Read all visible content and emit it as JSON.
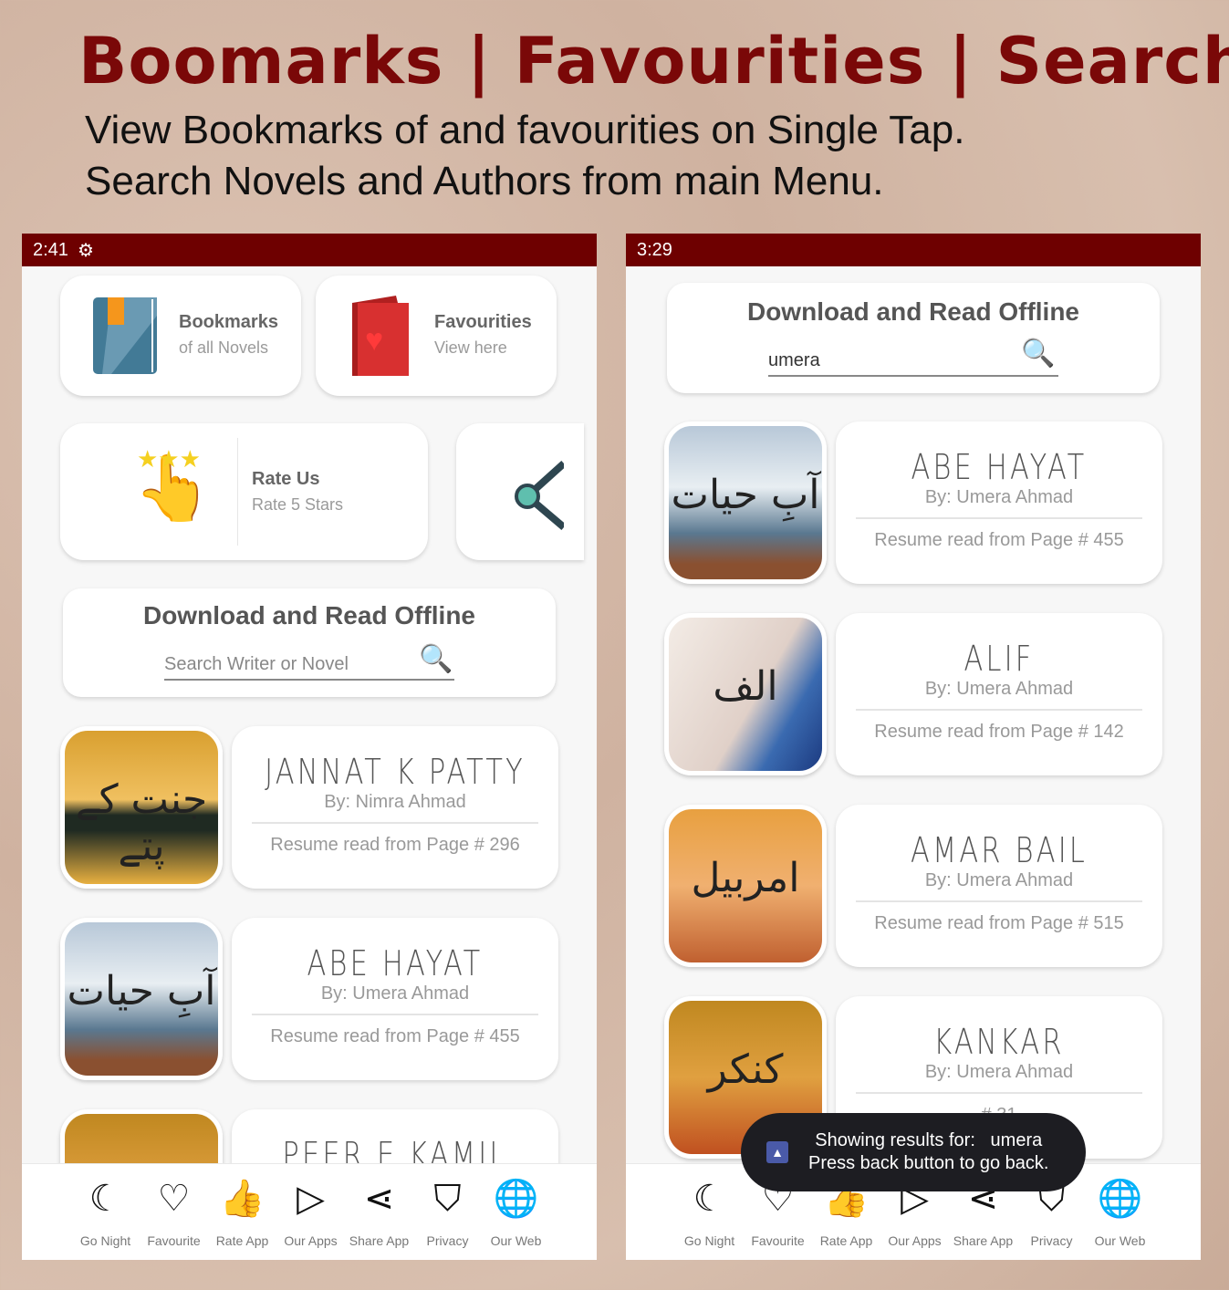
{
  "header": {
    "title": "Boomarks | Favourities | Search",
    "subtitle_line1": "View Bookmarks of and favourities on Single Tap.",
    "subtitle_line2": "Search Novels and Authors from main Menu."
  },
  "left": {
    "time": "2:41",
    "bookmarks": {
      "title": "Bookmarks",
      "subtitle": "of all Novels"
    },
    "favourites": {
      "title": "Favourities",
      "subtitle": "View here"
    },
    "rate": {
      "title": "Rate Us",
      "subtitle": "Rate 5 Stars"
    },
    "search": {
      "title": "Download and Read Offline",
      "value": "",
      "placeholder": "Search Writer or Novel"
    },
    "novels": [
      {
        "title": "JANNAT K PATTY",
        "author": "By: Nimra Ahmad",
        "resume": "Resume read from Page # 296",
        "cover_text": "جنت کے پتے"
      },
      {
        "title": "ABE HAYAT",
        "author": "By: Umera Ahmad",
        "resume": "Resume read from Page # 455",
        "cover_text": "آبِ حیات"
      },
      {
        "title": "PEER E KAMIL",
        "author": "",
        "resume": "",
        "cover_text": ""
      }
    ]
  },
  "right": {
    "time": "3:29",
    "search": {
      "title": "Download and Read Offline",
      "value": "umera",
      "placeholder": ""
    },
    "novels": [
      {
        "title": "ABE HAYAT",
        "author": "By: Umera Ahmad",
        "resume": "Resume read from Page # 455",
        "cover_text": "آبِ حیات"
      },
      {
        "title": "ALIF",
        "author": "By: Umera Ahmad",
        "resume": "Resume read from Page # 142",
        "cover_text": "الف"
      },
      {
        "title": "AMAR BAIL",
        "author": "By: Umera Ahmad",
        "resume": "Resume read from Page # 515",
        "cover_text": "امربیل"
      },
      {
        "title": "KANKAR",
        "author": "By: Umera Ahmad",
        "resume": "# 31",
        "cover_text": "کنکر"
      }
    ],
    "toast": {
      "line1": "Showing results for:   umera",
      "line2": "Press back button to go back."
    }
  },
  "nav": [
    {
      "label": "Go Night",
      "icon": "moon-icon",
      "glyph": "☾"
    },
    {
      "label": "Favourite",
      "icon": "heart-icon",
      "glyph": "♡"
    },
    {
      "label": "Rate App",
      "icon": "thumbs-up-icon",
      "glyph": "👍"
    },
    {
      "label": "Our Apps",
      "icon": "play-store-icon",
      "glyph": "▷"
    },
    {
      "label": "Share App",
      "icon": "share-icon",
      "glyph": "⋖"
    },
    {
      "label": "Privacy",
      "icon": "shield-user-icon",
      "glyph": "⛉"
    },
    {
      "label": "Our Web",
      "icon": "globe-icon",
      "glyph": "🌐"
    }
  ],
  "colors": {
    "brand": "#6e0000",
    "title": "#7a0808"
  }
}
